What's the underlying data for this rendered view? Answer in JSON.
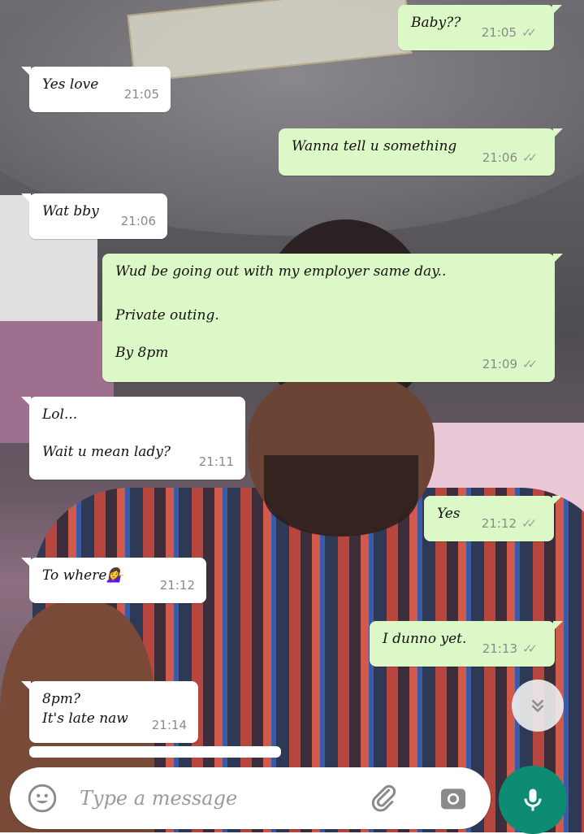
{
  "chat": {
    "messages": [
      {
        "dir": "out",
        "lines": [
          "Baby??"
        ],
        "time": "21:05",
        "ticks": "✓✓"
      },
      {
        "dir": "in",
        "lines": [
          "Yes love"
        ],
        "time": "21:05"
      },
      {
        "dir": "out",
        "lines": [
          "Wanna tell u something"
        ],
        "time": "21:06",
        "ticks": "✓✓"
      },
      {
        "dir": "in",
        "lines": [
          "Wat bby"
        ],
        "time": "21:06"
      },
      {
        "dir": "out",
        "lines": [
          "Wud be going out with my employer same day..",
          "",
          "Private outing.",
          "",
          "By 8pm"
        ],
        "time": "21:09",
        "ticks": "✓✓"
      },
      {
        "dir": "in",
        "lines": [
          "Lol...",
          "",
          "Wait u mean lady?"
        ],
        "time": "21:11"
      },
      {
        "dir": "out",
        "lines": [
          "Yes"
        ],
        "time": "21:12",
        "ticks": "✓✓"
      },
      {
        "dir": "in",
        "lines": [
          "To where💁‍♀️"
        ],
        "time": "21:12"
      },
      {
        "dir": "out",
        "lines": [
          "I dunno yet."
        ],
        "time": "21:13",
        "ticks": "✓✓"
      },
      {
        "dir": "in",
        "lines": [
          "8pm?",
          "It's late naw"
        ],
        "time": "21:14"
      }
    ]
  },
  "composer": {
    "placeholder": "Type a message",
    "emoji_icon": "emoji-icon",
    "attach_icon": "paperclip-icon",
    "camera_icon": "camera-icon",
    "mic_icon": "microphone-icon",
    "scroll_icon": "double-chevron-down-icon"
  },
  "colors": {
    "outgoing_bubble": "#dcf8c6",
    "incoming_bubble": "#ffffff",
    "mic_button": "#0e8c73"
  }
}
